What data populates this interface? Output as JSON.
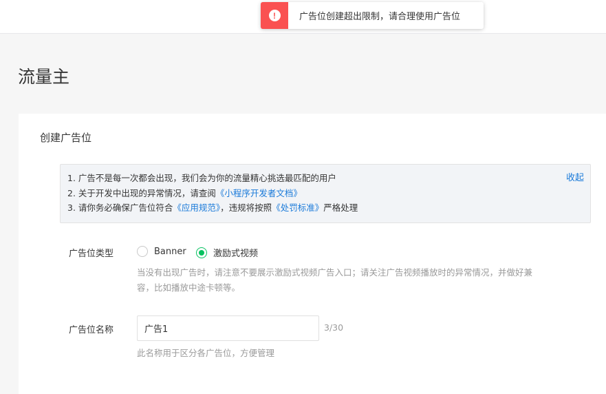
{
  "toast": {
    "message": "广告位创建超出限制，请合理使用广告位",
    "icon": "exclamation-icon",
    "color": "#fa5151"
  },
  "page": {
    "title": "流量主"
  },
  "form": {
    "section_title": "创建广告位",
    "notice": {
      "line1": "1. 广告不是每一次都会出现，我们会为你的流量精心挑选最匹配的用户",
      "line2_prefix": "2. 关于开发中出现的异常情况，请查阅",
      "line2_link": "《小程序开发者文档》",
      "line3_prefix": "3. 请你务必确保广告位符合",
      "line3_link1": "《应用规范》",
      "line3_mid": "，违规将按照",
      "line3_link2": "《处罚标准》",
      "line3_suffix": "严格处理",
      "collapse_label": "收起"
    },
    "type": {
      "label": "广告位类型",
      "options": [
        {
          "label": "Banner",
          "checked": false
        },
        {
          "label": "激励式视频",
          "checked": true
        }
      ],
      "hint_line1": "当没有出现广告时，请注意不要展示激励式视频广告入口；请关注广告视频播放时的异常情况，并做好兼",
      "hint_line2": "容，比如播放中途卡顿等。"
    },
    "name": {
      "label": "广告位名称",
      "value": "广告1",
      "counter": "3/30",
      "hint": "此名称用于区分各广告位，方便管理"
    }
  },
  "colors": {
    "accent": "#07c160",
    "link": "#1a7ad9",
    "error": "#fa5151"
  }
}
